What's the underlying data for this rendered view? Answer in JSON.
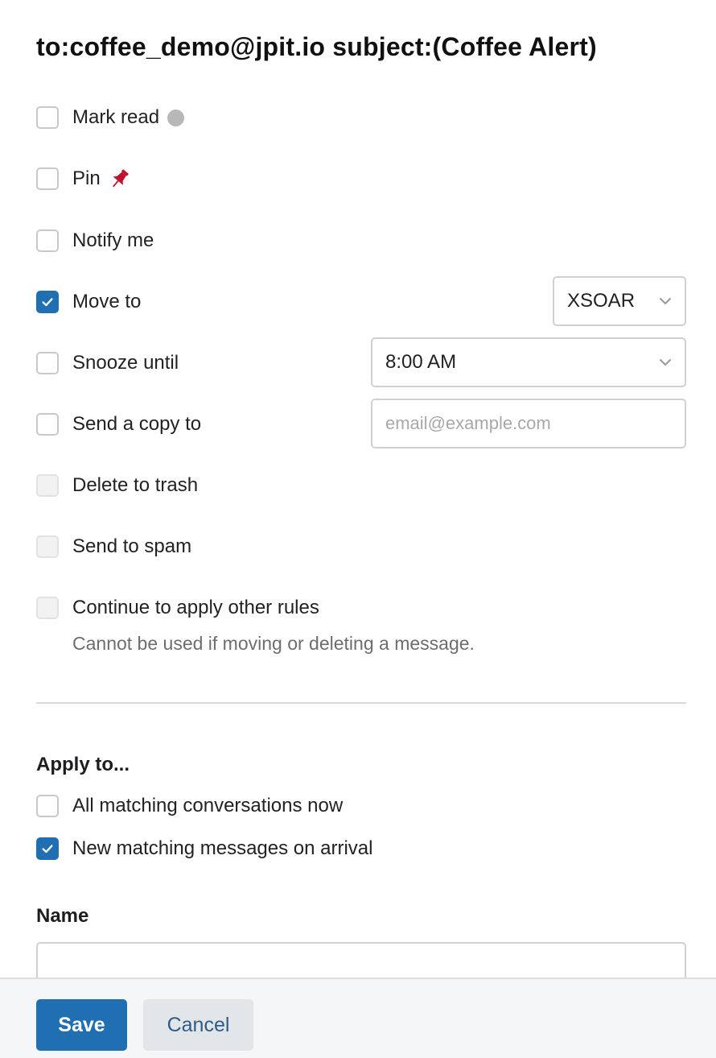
{
  "header": {
    "title": "to:coffee_demo@jpit.io subject:(Coffee Alert)"
  },
  "actions": {
    "mark_read": {
      "label": "Mark read",
      "checked": false
    },
    "pin": {
      "label": "Pin",
      "checked": false
    },
    "notify": {
      "label": "Notify me",
      "checked": false
    },
    "move_to": {
      "label": "Move to",
      "checked": true,
      "folder": "XSOAR"
    },
    "snooze": {
      "label": "Snooze until",
      "checked": false,
      "time": "8:00 AM"
    },
    "send_copy": {
      "label": "Send a copy to",
      "checked": false,
      "placeholder": "email@example.com"
    },
    "delete": {
      "label": "Delete to trash",
      "checked": false,
      "disabled": true
    },
    "spam": {
      "label": "Send to spam",
      "checked": false,
      "disabled": true
    },
    "continue": {
      "label": "Continue to apply other rules",
      "checked": false,
      "disabled": true,
      "hint": "Cannot be used if moving or deleting a message."
    }
  },
  "apply_to": {
    "title": "Apply to...",
    "all_now": {
      "label": "All matching conversations now",
      "checked": false
    },
    "new_arrival": {
      "label": "New matching messages on arrival",
      "checked": true
    }
  },
  "name_field": {
    "label": "Name",
    "value": ""
  },
  "footer": {
    "save_label": "Save",
    "cancel_label": "Cancel"
  },
  "colors": {
    "accent": "#1f6fb2",
    "pin": "#c0102a",
    "dot": "#b8b8b8"
  },
  "icons": [
    "check-icon",
    "grey-dot-icon",
    "pin-icon",
    "chevron-down-icon"
  ]
}
